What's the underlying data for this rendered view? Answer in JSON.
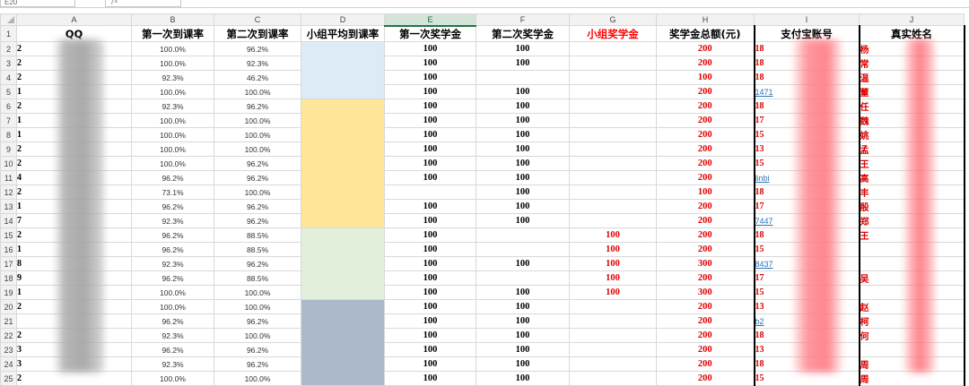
{
  "toolbar": {
    "cell_ref": "E20",
    "fx_label": "fx"
  },
  "columns": [
    "A",
    "B",
    "C",
    "D",
    "E",
    "F",
    "G",
    "H",
    "I",
    "J"
  ],
  "headers": [
    "QQ",
    "第一次到课率",
    "第二次到课率",
    "小组平均到课率",
    "第一次奖学金",
    "第二次奖学金",
    "小组奖学金",
    "奖学金总额(元)",
    "支付宝账号",
    "真实姓名"
  ],
  "colors": {
    "group1": "#ddebf7",
    "group2": "#ffe699",
    "group3": "#e2efda",
    "group4": "#acb9ca",
    "red": "#ff0000"
  },
  "rows": [
    {
      "n": "2",
      "qq": "2",
      "b": "100.0%",
      "c": "96.2%",
      "e": "100",
      "f": "100",
      "g": "",
      "h": "200",
      "pay": "18",
      "paytype": "ph",
      "name": "杨"
    },
    {
      "n": "3",
      "qq": "2",
      "b": "100.0%",
      "c": "92.3%",
      "e": "100",
      "f": "100",
      "g": "",
      "h": "200",
      "pay": "18",
      "paytype": "ph",
      "name": "常"
    },
    {
      "n": "4",
      "qq": "2",
      "b": "92.3%",
      "c": "46.2%",
      "e": "100",
      "f": "",
      "g": "",
      "h": "100",
      "pay": "18",
      "paytype": "ph",
      "name": "温"
    },
    {
      "n": "5",
      "qq": "1",
      "b": "100.0%",
      "c": "100.0%",
      "e": "100",
      "f": "100",
      "g": "",
      "h": "200",
      "pay": "1471",
      "paytype": "em",
      "name": "董"
    },
    {
      "n": "6",
      "qq": "2",
      "b": "92.3%",
      "c": "96.2%",
      "e": "100",
      "f": "100",
      "g": "",
      "h": "200",
      "pay": "18",
      "paytype": "ph",
      "name": "任"
    },
    {
      "n": "7",
      "qq": "1",
      "b": "100.0%",
      "c": "100.0%",
      "e": "100",
      "f": "100",
      "g": "",
      "h": "200",
      "pay": "17",
      "paytype": "ph",
      "name": "魏"
    },
    {
      "n": "8",
      "qq": "1",
      "b": "100.0%",
      "c": "100.0%",
      "e": "100",
      "f": "100",
      "g": "",
      "h": "200",
      "pay": "15",
      "paytype": "ph",
      "name": "姚"
    },
    {
      "n": "9",
      "qq": "2",
      "b": "100.0%",
      "c": "100.0%",
      "e": "100",
      "f": "100",
      "g": "",
      "h": "200",
      "pay": "13",
      "paytype": "ph",
      "name": "孟"
    },
    {
      "n": "10",
      "qq": "2",
      "b": "100.0%",
      "c": "96.2%",
      "e": "100",
      "f": "100",
      "g": "",
      "h": "200",
      "pay": "15",
      "paytype": "ph",
      "name": "王"
    },
    {
      "n": "11",
      "qq": "4",
      "b": "96.2%",
      "c": "96.2%",
      "e": "100",
      "f": "100",
      "g": "",
      "h": "200",
      "pay": "linbi",
      "paytype": "em",
      "name": "高"
    },
    {
      "n": "12",
      "qq": "2",
      "b": "73.1%",
      "c": "100.0%",
      "e": "",
      "f": "100",
      "g": "",
      "h": "100",
      "pay": "18",
      "paytype": "ph",
      "name": "丰"
    },
    {
      "n": "13",
      "qq": "1",
      "b": "96.2%",
      "c": "96.2%",
      "e": "100",
      "f": "100",
      "g": "",
      "h": "200",
      "pay": "17",
      "paytype": "ph",
      "name": "殷"
    },
    {
      "n": "14",
      "qq": "7",
      "b": "92.3%",
      "c": "96.2%",
      "e": "100",
      "f": "100",
      "g": "",
      "h": "200",
      "pay": "7447",
      "paytype": "em",
      "name": "郑"
    },
    {
      "n": "15",
      "qq": "2",
      "b": "96.2%",
      "c": "88.5%",
      "e": "100",
      "f": "",
      "g": "100",
      "h": "200",
      "pay": "18",
      "paytype": "ph",
      "name": "王"
    },
    {
      "n": "16",
      "qq": "1",
      "b": "96.2%",
      "c": "88.5%",
      "e": "100",
      "f": "",
      "g": "100",
      "h": "200",
      "pay": "15",
      "paytype": "ph",
      "name": ""
    },
    {
      "n": "17",
      "qq": "8",
      "b": "92.3%",
      "c": "96.2%",
      "e": "100",
      "f": "100",
      "g": "100",
      "h": "300",
      "pay": "8437",
      "paytype": "em",
      "name": ""
    },
    {
      "n": "18",
      "qq": "9",
      "b": "96.2%",
      "c": "88.5%",
      "e": "100",
      "f": "",
      "g": "100",
      "h": "200",
      "pay": "17",
      "paytype": "ph",
      "name": "吴"
    },
    {
      "n": "19",
      "qq": "1",
      "b": "100.0%",
      "c": "100.0%",
      "e": "100",
      "f": "100",
      "g": "100",
      "h": "300",
      "pay": "15",
      "paytype": "ph",
      "name": ""
    },
    {
      "n": "20",
      "qq": "2",
      "b": "100.0%",
      "c": "100.0%",
      "e": "100",
      "f": "100",
      "g": "",
      "h": "200",
      "pay": "13",
      "paytype": "ph",
      "name": "赵"
    },
    {
      "n": "21",
      "qq": "",
      "b": "96.2%",
      "c": "96.2%",
      "e": "100",
      "f": "100",
      "g": "",
      "h": "200",
      "pay": "b2",
      "paytype": "em",
      "name": "柯"
    },
    {
      "n": "22",
      "qq": "2",
      "b": "92.3%",
      "c": "100.0%",
      "e": "100",
      "f": "100",
      "g": "",
      "h": "200",
      "pay": "18",
      "paytype": "ph",
      "name": "何"
    },
    {
      "n": "23",
      "qq": "3",
      "b": "96.2%",
      "c": "96.2%",
      "e": "100",
      "f": "100",
      "g": "",
      "h": "200",
      "pay": "13",
      "paytype": "ph",
      "name": ""
    },
    {
      "n": "24",
      "qq": "3",
      "b": "92.3%",
      "c": "96.2%",
      "e": "100",
      "f": "100",
      "g": "",
      "h": "200",
      "pay": "18",
      "paytype": "ph",
      "name": "周"
    },
    {
      "n": "25",
      "qq": "2",
      "b": "100.0%",
      "c": "100.0%",
      "e": "100",
      "f": "100",
      "g": "",
      "h": "200",
      "pay": "15",
      "paytype": "ph",
      "name": "周"
    }
  ]
}
